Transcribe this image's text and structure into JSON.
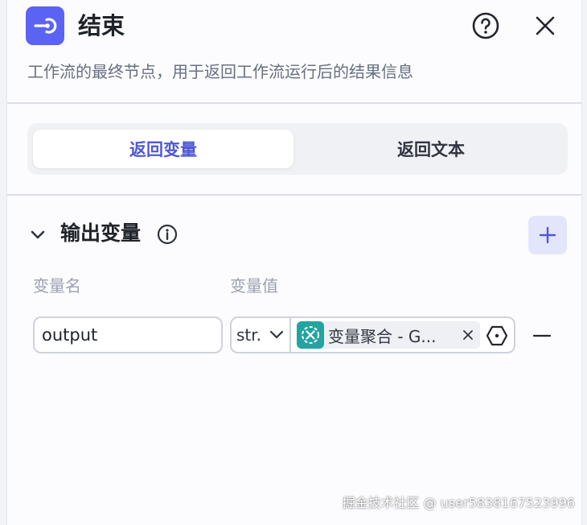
{
  "header": {
    "title": "结束",
    "description": "工作流的最终节点，用于返回工作流运行后的结果信息"
  },
  "tabs": [
    {
      "label": "返回变量",
      "active": true
    },
    {
      "label": "返回文本",
      "active": false
    }
  ],
  "output_section": {
    "title": "输出变量",
    "col_name": "变量名",
    "col_value": "变量值",
    "rows": [
      {
        "name": "output",
        "type": "str.",
        "ref_text": "变量聚合 - G..."
      }
    ]
  },
  "watermark": "掘金技术社区 @ user5838167523996",
  "colors": {
    "accent": "#5b63f5",
    "active_tab_text": "#4f58d6",
    "tag_icon": "#22a5a0",
    "add_button_bg": "#e3e6fb"
  },
  "icons": {
    "node": "end-node-icon",
    "help": "help-circle-icon",
    "close": "close-icon",
    "collapse": "chevron-down-icon",
    "info": "info-icon",
    "add": "plus-icon",
    "ref": "variable-aggregator-icon",
    "var": "variable-hexagon-icon",
    "remove": "minus-icon"
  }
}
